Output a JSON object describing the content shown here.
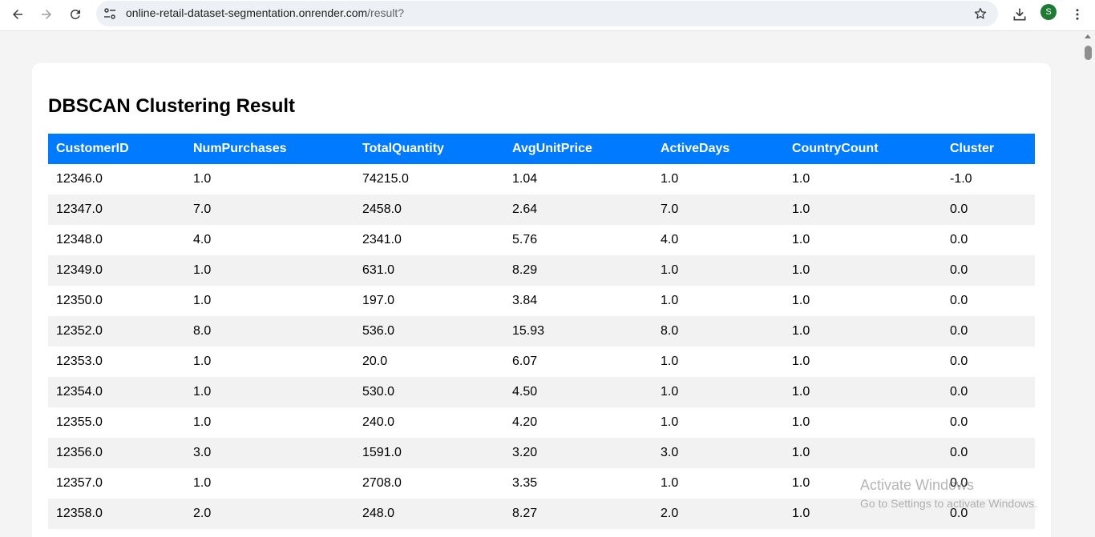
{
  "browser": {
    "url_host": "online-retail-dataset-segmentation.onrender.com",
    "url_path": "/result?",
    "avatar_letter": "S"
  },
  "page": {
    "title": "DBSCAN Clustering Result"
  },
  "table": {
    "columns": [
      "CustomerID",
      "NumPurchases",
      "TotalQuantity",
      "AvgUnitPrice",
      "ActiveDays",
      "CountryCount",
      "Cluster"
    ],
    "rows": [
      [
        "12346.0",
        "1.0",
        "74215.0",
        "1.04",
        "1.0",
        "1.0",
        "-1.0"
      ],
      [
        "12347.0",
        "7.0",
        "2458.0",
        "2.64",
        "7.0",
        "1.0",
        "0.0"
      ],
      [
        "12348.0",
        "4.0",
        "2341.0",
        "5.76",
        "4.0",
        "1.0",
        "0.0"
      ],
      [
        "12349.0",
        "1.0",
        "631.0",
        "8.29",
        "1.0",
        "1.0",
        "0.0"
      ],
      [
        "12350.0",
        "1.0",
        "197.0",
        "3.84",
        "1.0",
        "1.0",
        "0.0"
      ],
      [
        "12352.0",
        "8.0",
        "536.0",
        "15.93",
        "8.0",
        "1.0",
        "0.0"
      ],
      [
        "12353.0",
        "1.0",
        "20.0",
        "6.07",
        "1.0",
        "1.0",
        "0.0"
      ],
      [
        "12354.0",
        "1.0",
        "530.0",
        "4.50",
        "1.0",
        "1.0",
        "0.0"
      ],
      [
        "12355.0",
        "1.0",
        "240.0",
        "4.20",
        "1.0",
        "1.0",
        "0.0"
      ],
      [
        "12356.0",
        "3.0",
        "1591.0",
        "3.20",
        "3.0",
        "1.0",
        "0.0"
      ],
      [
        "12357.0",
        "1.0",
        "2708.0",
        "3.35",
        "1.0",
        "1.0",
        "0.0"
      ],
      [
        "12358.0",
        "2.0",
        "248.0",
        "8.27",
        "2.0",
        "1.0",
        "0.0"
      ]
    ]
  },
  "watermark": {
    "line1": "Activate Windows",
    "line2": "Go to Settings to activate Windows."
  },
  "colors": {
    "header_bg": "#007bff",
    "header_text": "#ffffff",
    "stripe": "#f2f2f2"
  }
}
